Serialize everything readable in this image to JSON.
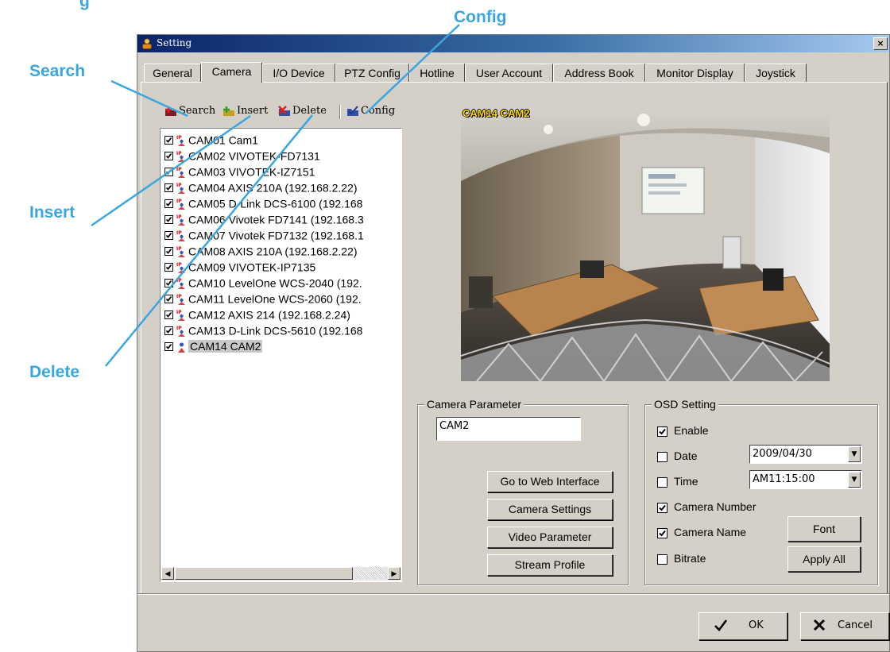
{
  "callouts": {
    "top_partial": "g",
    "search": "Search",
    "insert": "Insert",
    "delete": "Delete",
    "config": "Config"
  },
  "window": {
    "title": "Setting",
    "close_glyph": "×"
  },
  "tabs": [
    {
      "label": "General",
      "active": false
    },
    {
      "label": "Camera",
      "active": true
    },
    {
      "label": "I/O Device",
      "active": false
    },
    {
      "label": "PTZ Config",
      "active": false
    },
    {
      "label": "Hotline",
      "active": false
    },
    {
      "label": "User Account",
      "active": false
    },
    {
      "label": "Address Book",
      "active": false
    },
    {
      "label": "Monitor Display",
      "active": false
    },
    {
      "label": "Joystick",
      "active": false
    }
  ],
  "toolbar": {
    "search": "Search",
    "insert": "Insert",
    "delete": "Delete",
    "config": "Config"
  },
  "camera_list": [
    {
      "label": "CAM01 Cam1",
      "checked": true
    },
    {
      "label": "CAM02 VIVOTEK-FD7131",
      "checked": true
    },
    {
      "label": "CAM03 VIVOTEK-IZ7151",
      "checked": true
    },
    {
      "label": "CAM04 AXIS 210A (192.168.2.22)",
      "checked": true
    },
    {
      "label": "CAM05 D-Link DCS-6100 (192.168",
      "checked": true
    },
    {
      "label": "CAM06 Vivotek FD7141 (192.168.3",
      "checked": true
    },
    {
      "label": "CAM07 Vivotek FD7132 (192.168.1",
      "checked": true
    },
    {
      "label": "CAM08 AXIS 210A (192.168.2.22)",
      "checked": true
    },
    {
      "label": "CAM09 VIVOTEK-IP7135",
      "checked": true
    },
    {
      "label": "CAM10 LevelOne WCS-2040 (192.",
      "checked": true
    },
    {
      "label": "CAM11 LevelOne WCS-2060 (192.",
      "checked": true
    },
    {
      "label": "CAM12 AXIS 214 (192.168.2.24)",
      "checked": true
    },
    {
      "label": "CAM13 D-Link DCS-5610 (192.168",
      "checked": true
    },
    {
      "label": "CAM14 CAM2",
      "checked": true,
      "selected": true
    }
  ],
  "preview": {
    "overlay_text": "CAM14 CAM2"
  },
  "camera_parameter": {
    "legend": "Camera Parameter",
    "name_value": "CAM2",
    "buttons": {
      "web": "Go to Web Interface",
      "settings": "Camera Settings",
      "video": "Video Parameter",
      "stream": "Stream Profile"
    }
  },
  "osd": {
    "legend": "OSD Setting",
    "enable": {
      "label": "Enable",
      "checked": true
    },
    "date": {
      "label": "Date",
      "checked": false,
      "value": "2009/04/30"
    },
    "time": {
      "label": "Time",
      "checked": false,
      "value": "AM11:15:00"
    },
    "camera_number": {
      "label": "Camera Number",
      "checked": true
    },
    "camera_name": {
      "label": "Camera Name",
      "checked": true
    },
    "bitrate": {
      "label": "Bitrate",
      "checked": false
    },
    "font_button": "Font",
    "apply_all_button": "Apply All"
  },
  "dialog": {
    "ok": "OK",
    "cancel": "Cancel"
  },
  "colors": {
    "callout": "#3aa6e0",
    "face": "#d4d0c8",
    "title_start": "#0a246a",
    "osd_label": "#ffd800"
  }
}
